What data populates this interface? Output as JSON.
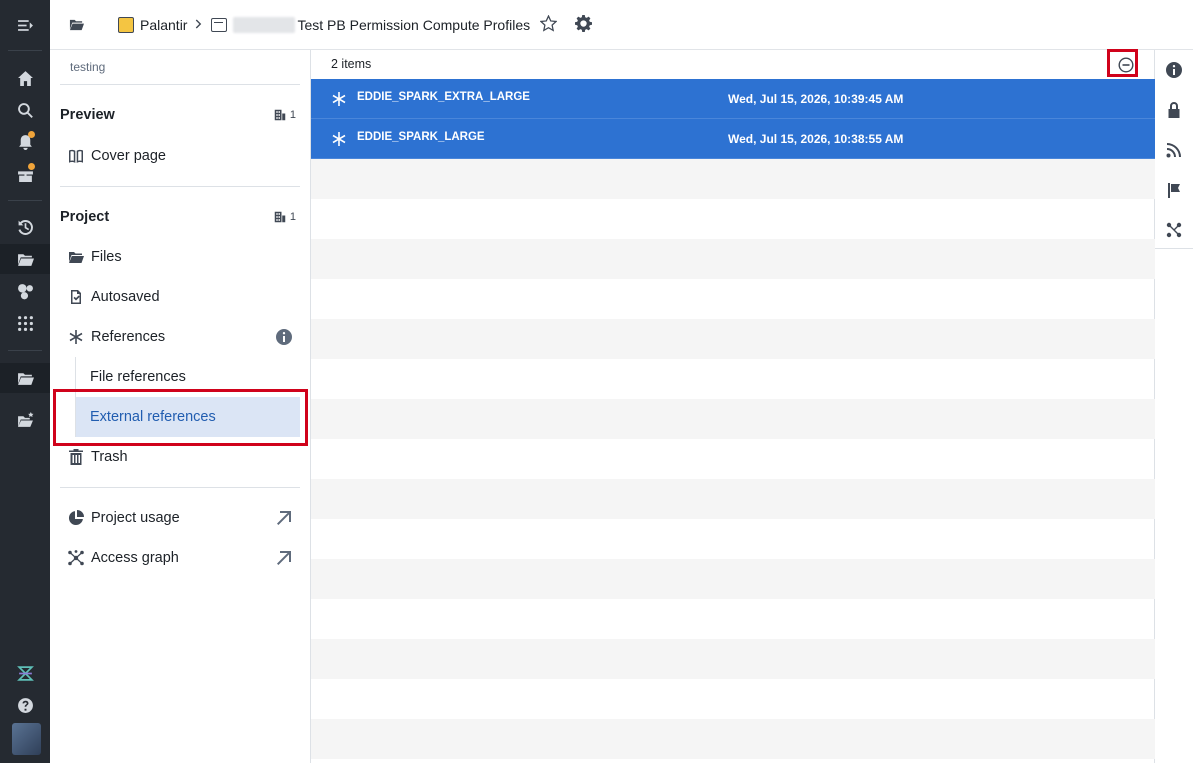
{
  "topbar": {
    "breadcrumb_root": "Palantir",
    "project_title": "Test PB Permission Compute Profiles"
  },
  "sidebar": {
    "hint": "testing",
    "preview": {
      "label": "Preview",
      "count": "1",
      "items": [
        {
          "label": "Cover page"
        }
      ]
    },
    "project": {
      "label": "Project",
      "count": "1",
      "items": [
        {
          "label": "Files"
        },
        {
          "label": "Autosaved"
        },
        {
          "label": "References"
        },
        {
          "label": "File references"
        },
        {
          "label": "External references"
        },
        {
          "label": "Trash"
        }
      ]
    },
    "links": [
      {
        "label": "Project usage"
      },
      {
        "label": "Access graph"
      }
    ]
  },
  "main": {
    "count_label": "2 items",
    "rows": [
      {
        "name": "EDDIE_SPARK_EXTRA_LARGE",
        "date": "Wed, Jul 15, 2026, 10:39:45 AM"
      },
      {
        "name": "EDDIE_SPARK_LARGE",
        "date": "Wed, Jul 15, 2026, 10:38:55 AM"
      }
    ]
  },
  "colors": {
    "rail_bg": "#252a31",
    "accent": "#2d72d2",
    "selected_bg": "#dbe5f5",
    "highlight": "#d0021b",
    "notification": "#f0a43a"
  }
}
